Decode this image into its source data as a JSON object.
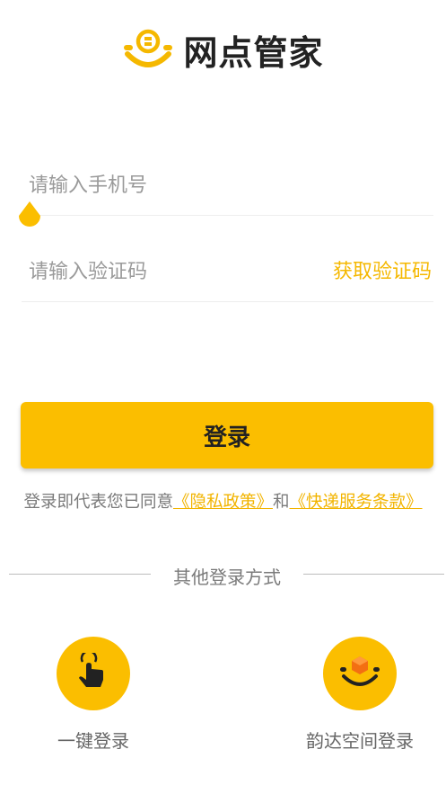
{
  "app": {
    "logo_text": "网点管家"
  },
  "form": {
    "phone_placeholder": "请输入手机号",
    "code_placeholder": "请输入验证码",
    "get_code_label": "获取验证码"
  },
  "login_button": "登录",
  "agreement": {
    "prefix": "登录即代表您已同意",
    "privacy_link": "《隐私政策》",
    "and": "和",
    "terms_link": "《快递服务条款》"
  },
  "other_methods": {
    "title": "其他登录方式",
    "items": [
      {
        "label": "一键登录",
        "icon": "tap-hand-icon"
      },
      {
        "label": "韵达空间登录",
        "icon": "yunda-smile-icon"
      }
    ]
  },
  "colors": {
    "brand": "#fbbe00",
    "link": "#f2b400"
  }
}
